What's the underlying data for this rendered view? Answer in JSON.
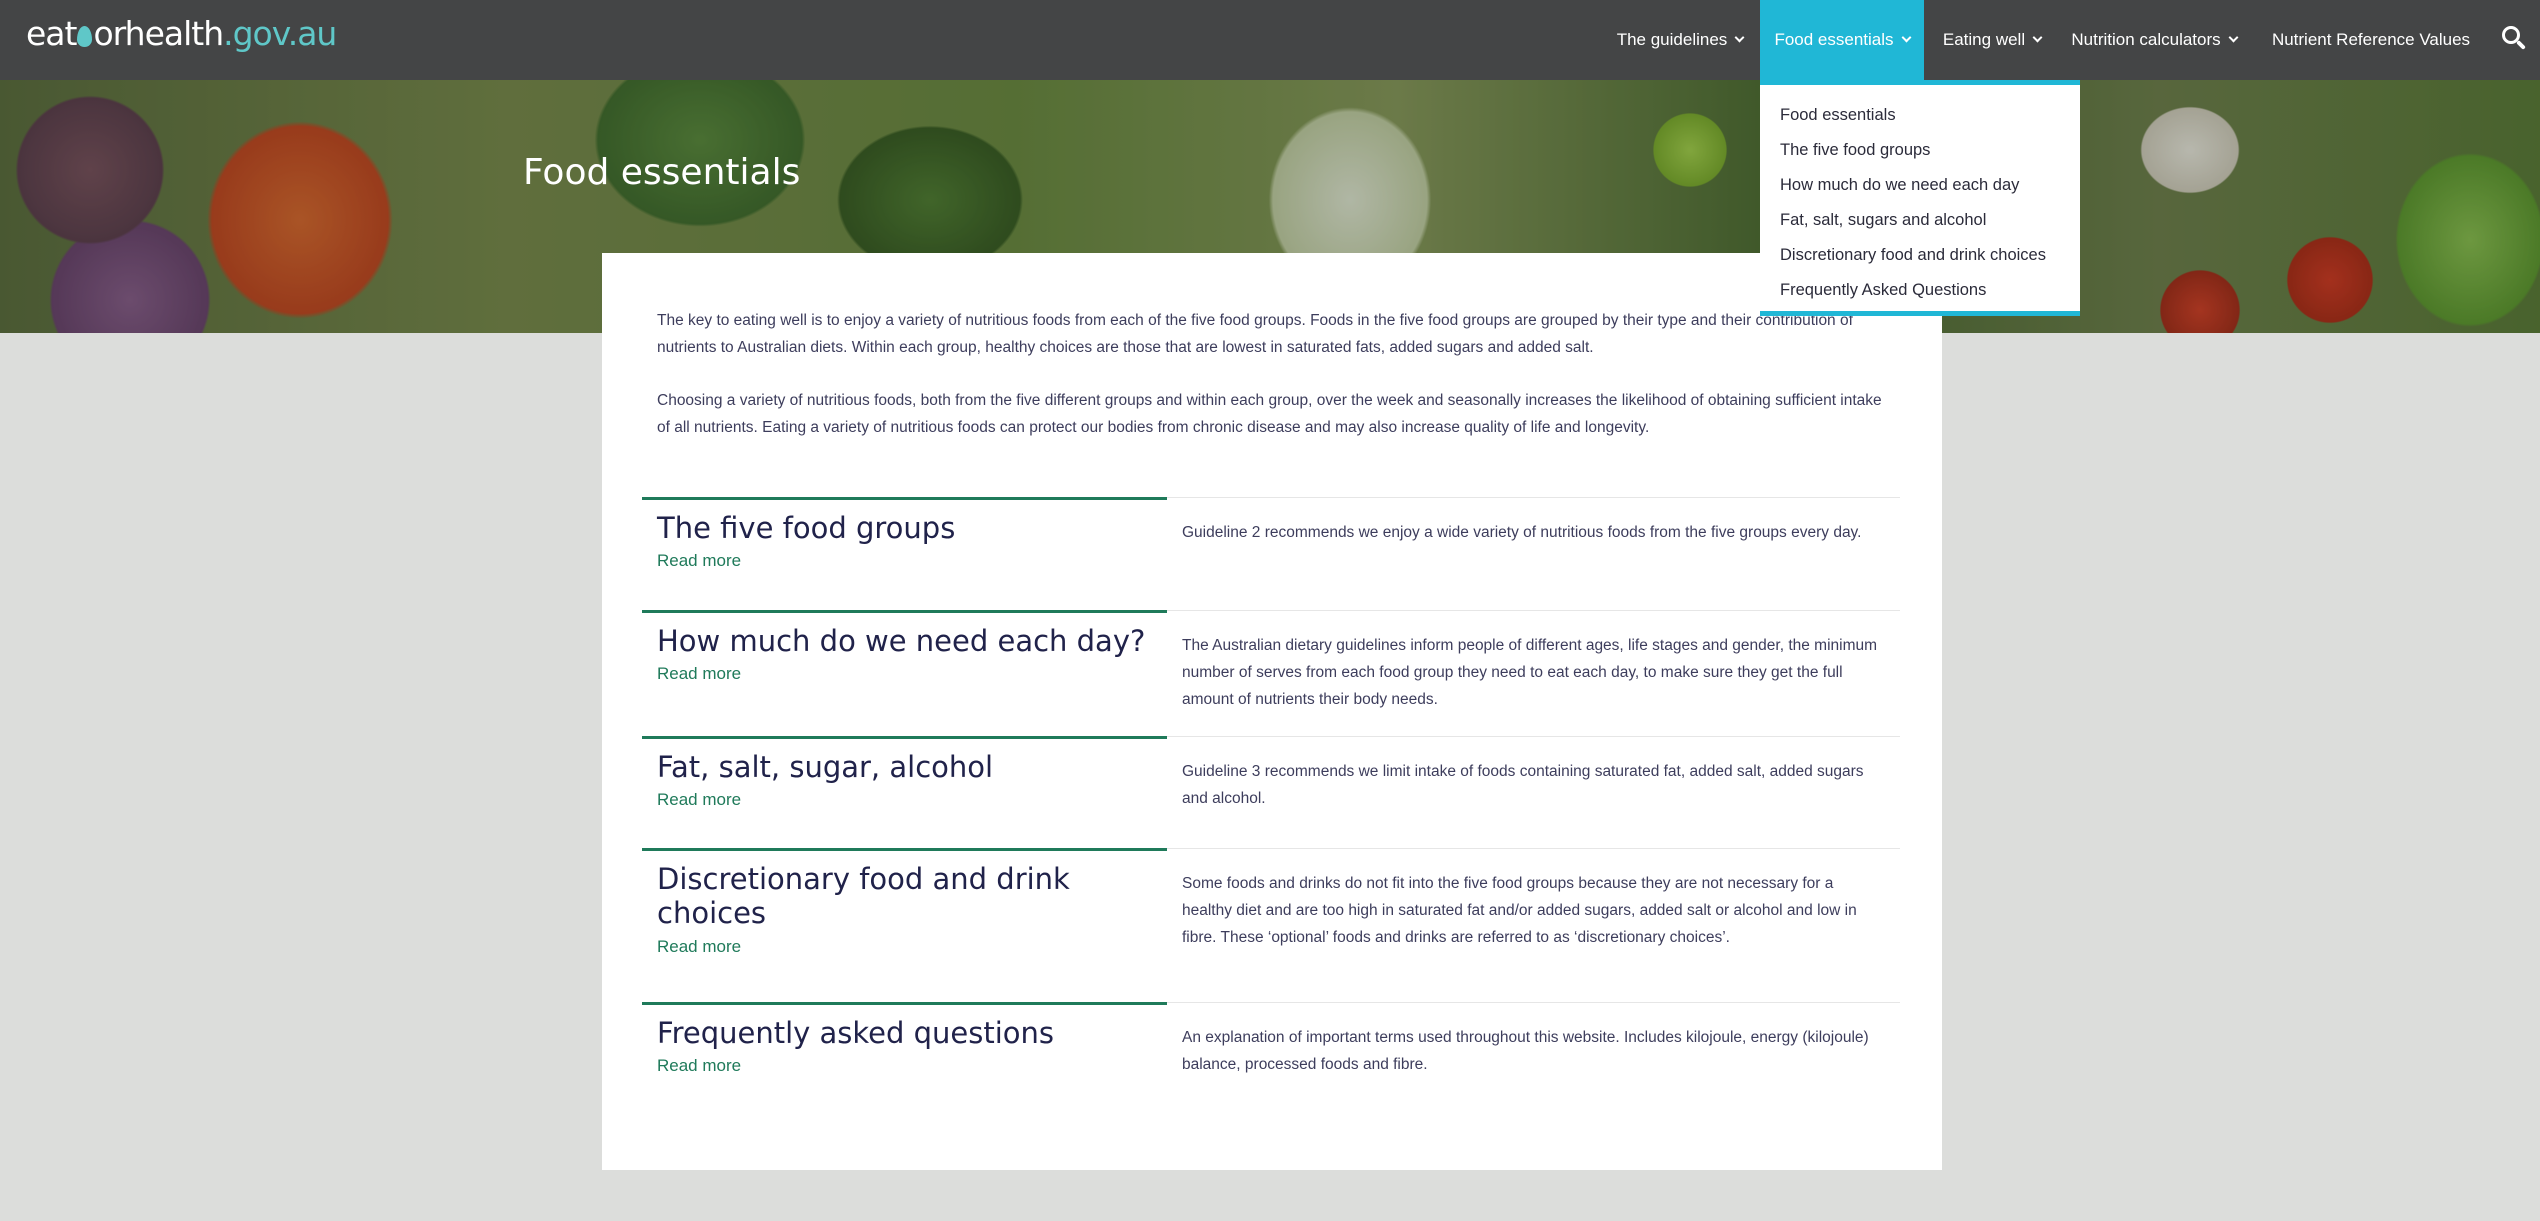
{
  "site": {
    "logo_part1": "eat",
    "logo_part2": "or",
    "logo_part3": "health",
    "logo_part4": ".gov.au"
  },
  "nav": {
    "items": [
      {
        "label": "The guidelines",
        "has_dropdown": true
      },
      {
        "label": "Food essentials",
        "has_dropdown": true,
        "active": true
      },
      {
        "label": "Eating well",
        "has_dropdown": true
      },
      {
        "label": "Nutrition calculators",
        "has_dropdown": true
      },
      {
        "label": "Nutrient Reference Values",
        "has_dropdown": false
      }
    ],
    "search_icon": "search-icon"
  },
  "dropdown": {
    "items": [
      "Food essentials",
      "The five food groups",
      "How much do we need each day",
      "Fat, salt, sugars and alcohol",
      "Discretionary food and drink choices",
      "Frequently Asked Questions"
    ]
  },
  "hero": {
    "title": "Food essentials"
  },
  "intro": {
    "p1": "The key to eating well is to enjoy a variety of nutritious foods from each of the five food groups. Foods in the five food groups are grouped by their type and their contribution of nutrients to Australian diets. Within each group, healthy choices are those that are lowest in saturated fats, added sugars and added salt.",
    "p2": "Choosing a variety of nutritious foods, both from the five different groups and within each group, over the week and seasonally increases the likelihood of obtaining sufficient intake of all nutrients. Eating a variety of nutritious foods can protect our bodies from chronic disease and may also increase quality of life and longevity."
  },
  "sections": [
    {
      "heading": "The five food groups",
      "read_more": "Read more",
      "description": "Guideline 2 recommends we enjoy a wide variety of nutritious foods from the five groups every day."
    },
    {
      "heading": "How much do we need each day?",
      "read_more": "Read more",
      "description": "The Australian dietary guidelines inform people of different ages, life stages and gender, the minimum number of serves from each food group they need to eat each day, to make sure they get the full amount of nutrients their body needs."
    },
    {
      "heading": "Fat, salt, sugar, alcohol",
      "read_more": "Read more",
      "description": "Guideline 3 recommends we limit intake of foods containing saturated fat, added salt, added sugars and alcohol."
    },
    {
      "heading": "Discretionary food and drink choices",
      "read_more": "Read more",
      "description": "Some foods and drinks do not fit into the five food groups because they are not necessary for a healthy diet and are too high in saturated fat and/or added sugars, added salt or alcohol and low in fibre. These ‘optional’ foods and drinks are referred to as ‘discretionary choices’."
    },
    {
      "heading": "Frequently asked questions",
      "read_more": "Read more",
      "description": "An explanation of important terms used throughout this website. Includes kilojoule, energy (kilojoule) balance, processed foods and fibre."
    }
  ],
  "colors": {
    "topbar": "#444546",
    "accent": "#20b7d6",
    "green": "#1f7a5a",
    "logo_teal": "#5fc7c8",
    "page_bg": "#dcdddb"
  }
}
